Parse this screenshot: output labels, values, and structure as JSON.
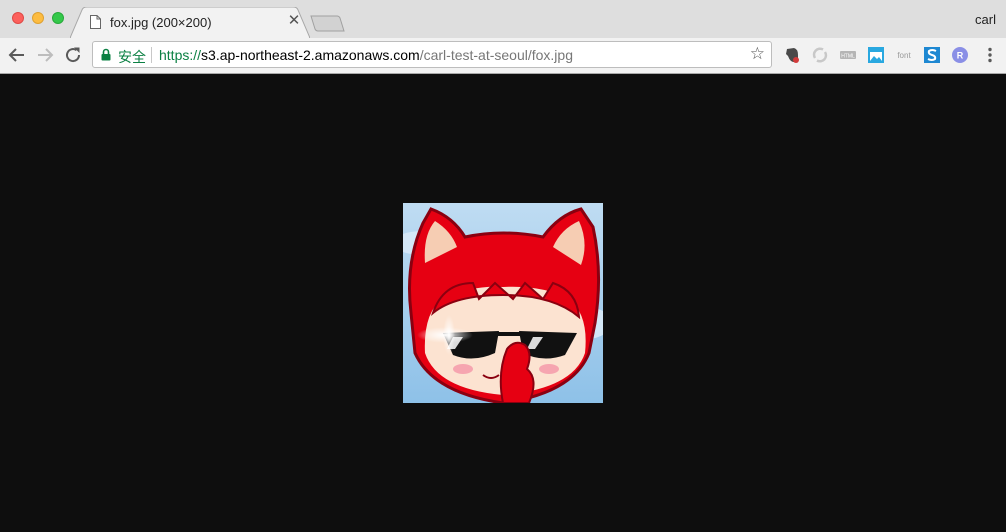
{
  "tab": {
    "title": "fox.jpg (200×200)"
  },
  "profile": {
    "name": "carl"
  },
  "omnibox": {
    "secure_label": "安全",
    "url_scheme": "https://",
    "url_host": "s3.ap-northeast-2.amazonaws.com",
    "url_path": "/carl-test-at-seoul/fox.jpg"
  },
  "extensions": [
    {
      "icon": "evernote-icon"
    },
    {
      "icon": "sync-icon"
    },
    {
      "icon": "html-badge-icon",
      "label": "HTML"
    },
    {
      "icon": "image-icon"
    },
    {
      "icon": "font-icon",
      "label": "font"
    },
    {
      "icon": "s-icon"
    },
    {
      "icon": "r-icon",
      "label": "R"
    },
    {
      "icon": "menu-icon"
    }
  ],
  "image": {
    "alt": "fox character"
  },
  "colors": {
    "secure_green": "#0b8043",
    "page_bg": "#0e0e0e",
    "fox_red": "#e60012"
  }
}
